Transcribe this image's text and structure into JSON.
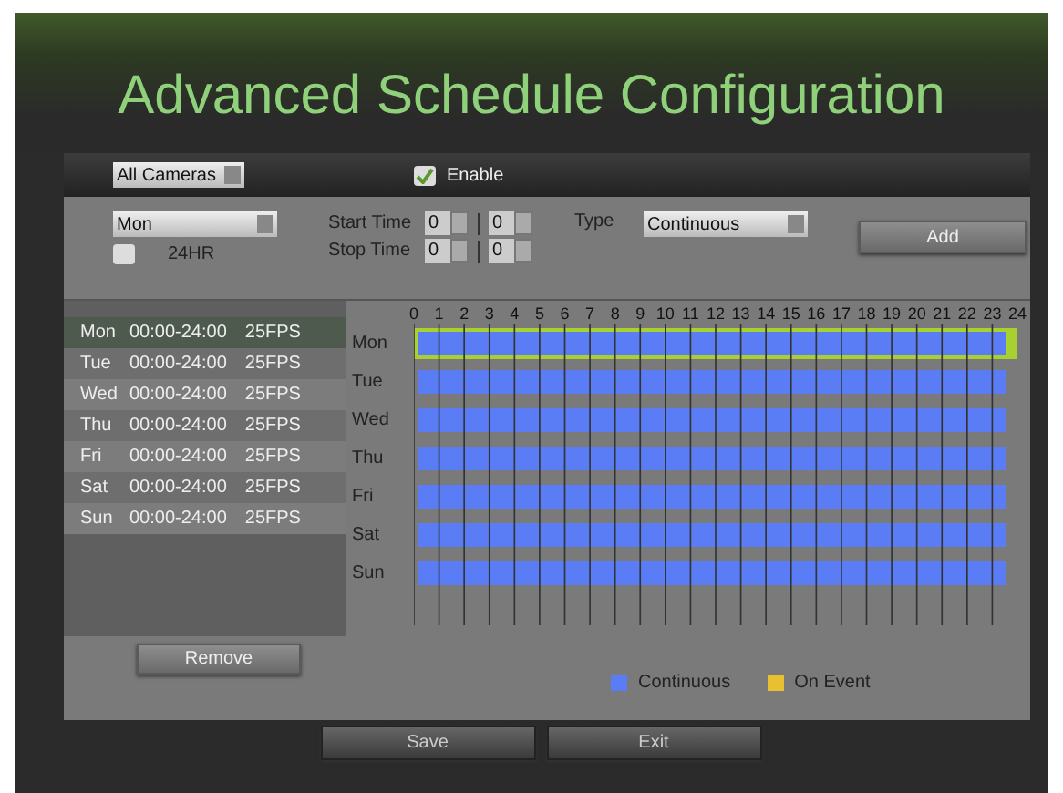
{
  "window": {
    "title": "Advanced Schedule Configuration"
  },
  "camera_select": {
    "value": "All Cameras"
  },
  "enable": {
    "label": "Enable",
    "checked": true
  },
  "day_select": {
    "value": "Mon"
  },
  "all_day": {
    "label": "24HR",
    "checked": false
  },
  "start_time": {
    "label": "Start Time",
    "hour": "0",
    "minute": "0"
  },
  "stop_time": {
    "label": "Stop Time",
    "hour": "0",
    "minute": "0"
  },
  "type_select": {
    "label": "Type",
    "value": "Continuous"
  },
  "add_button": "Add",
  "schedule_list": [
    {
      "day": "Mon",
      "time": "00:00-24:00",
      "fps": "25FPS",
      "selected": true
    },
    {
      "day": "Tue",
      "time": "00:00-24:00",
      "fps": "25FPS",
      "selected": false
    },
    {
      "day": "Wed",
      "time": "00:00-24:00",
      "fps": "25FPS",
      "selected": false
    },
    {
      "day": "Thu",
      "time": "00:00-24:00",
      "fps": "25FPS",
      "selected": false
    },
    {
      "day": "Fri",
      "time": "00:00-24:00",
      "fps": "25FPS",
      "selected": false
    },
    {
      "day": "Sat",
      "time": "00:00-24:00",
      "fps": "25FPS",
      "selected": false
    },
    {
      "day": "Sun",
      "time": "00:00-24:00",
      "fps": "25FPS",
      "selected": false
    }
  ],
  "hours": [
    "0",
    "1",
    "2",
    "3",
    "4",
    "5",
    "6",
    "7",
    "8",
    "9",
    "10",
    "11",
    "12",
    "13",
    "14",
    "15",
    "16",
    "17",
    "18",
    "19",
    "20",
    "21",
    "22",
    "23",
    "24"
  ],
  "timeline": [
    {
      "day": "Mon",
      "selected": true,
      "kind": "continuous"
    },
    {
      "day": "Tue",
      "selected": false,
      "kind": "continuous"
    },
    {
      "day": "Wed",
      "selected": false,
      "kind": "continuous"
    },
    {
      "day": "Thu",
      "selected": false,
      "kind": "continuous"
    },
    {
      "day": "Fri",
      "selected": false,
      "kind": "continuous"
    },
    {
      "day": "Sat",
      "selected": false,
      "kind": "continuous"
    },
    {
      "day": "Sun",
      "selected": false,
      "kind": "continuous"
    }
  ],
  "remove_button": "Remove",
  "legend": [
    {
      "kind": "continuous",
      "label": "Continuous",
      "color": "#5a7cf5"
    },
    {
      "kind": "event",
      "label": "On Event",
      "color": "#e8c030"
    }
  ],
  "buttons": [
    "Save",
    "Exit"
  ]
}
